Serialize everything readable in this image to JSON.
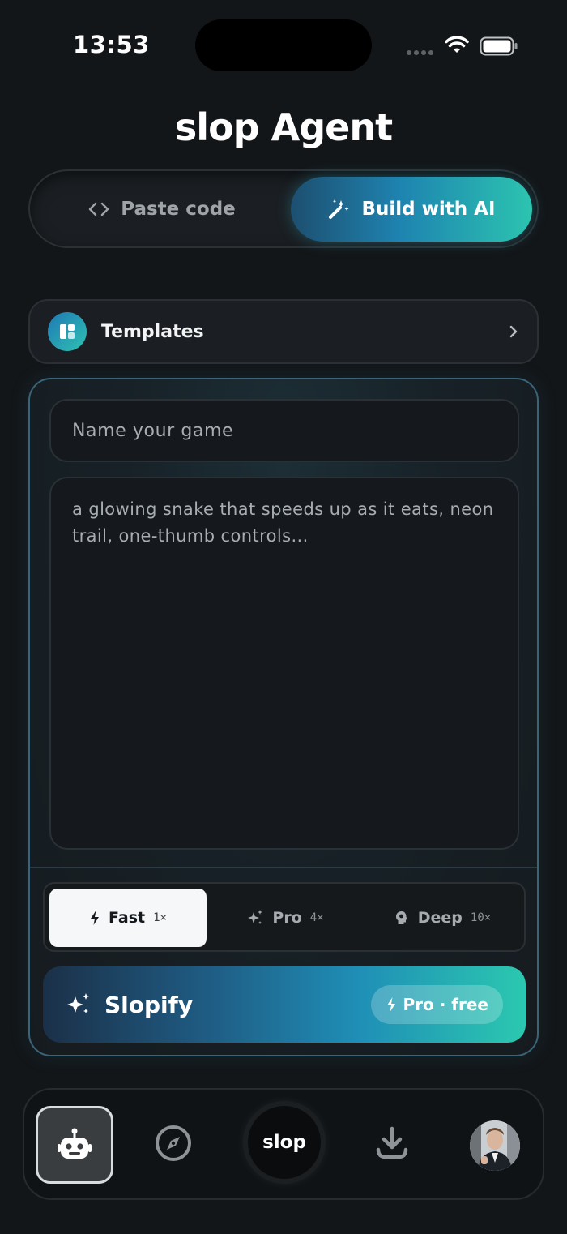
{
  "status_bar": {
    "time": "13:53",
    "icons": [
      "signal-icon",
      "wifi-icon",
      "battery-icon"
    ]
  },
  "header": {
    "title": "slop Agent"
  },
  "mode_switch": {
    "options": [
      {
        "label": "Paste code",
        "icon": "code-brackets-icon",
        "selected": false
      },
      {
        "label": "Build with AI",
        "icon": "magic-wand-icon",
        "selected": true
      }
    ]
  },
  "templates": {
    "label": "Templates",
    "icon": "layout-icon"
  },
  "composer": {
    "name_placeholder": "Name your game",
    "prompt_placeholder": "a glowing snake that speeds up as it eats, neon trail, one-thumb controls...",
    "speed_options": [
      {
        "label": "Fast",
        "multiplier": "1×",
        "icon": "bolt-icon",
        "selected": true
      },
      {
        "label": "Pro",
        "multiplier": "4×",
        "icon": "sparkles-icon",
        "selected": false
      },
      {
        "label": "Deep",
        "multiplier": "10×",
        "icon": "brain-icon",
        "selected": false
      }
    ],
    "submit": {
      "label": "Slopify",
      "icon": "sparkles-icon",
      "badge": "Pro · free",
      "badge_icon": "bolt-icon"
    }
  },
  "bottom_nav": {
    "items": [
      {
        "name": "agent",
        "icon": "robot-icon",
        "active": true
      },
      {
        "name": "explore",
        "icon": "compass-icon",
        "active": false
      },
      {
        "name": "home",
        "label": "slop",
        "active": false
      },
      {
        "name": "downloads",
        "icon": "download-icon",
        "active": false
      },
      {
        "name": "profile",
        "icon": "avatar",
        "active": false
      }
    ]
  },
  "colors": {
    "background": "#131619",
    "accent_start": "#1e83b0",
    "accent_end": "#2cc4b0"
  }
}
